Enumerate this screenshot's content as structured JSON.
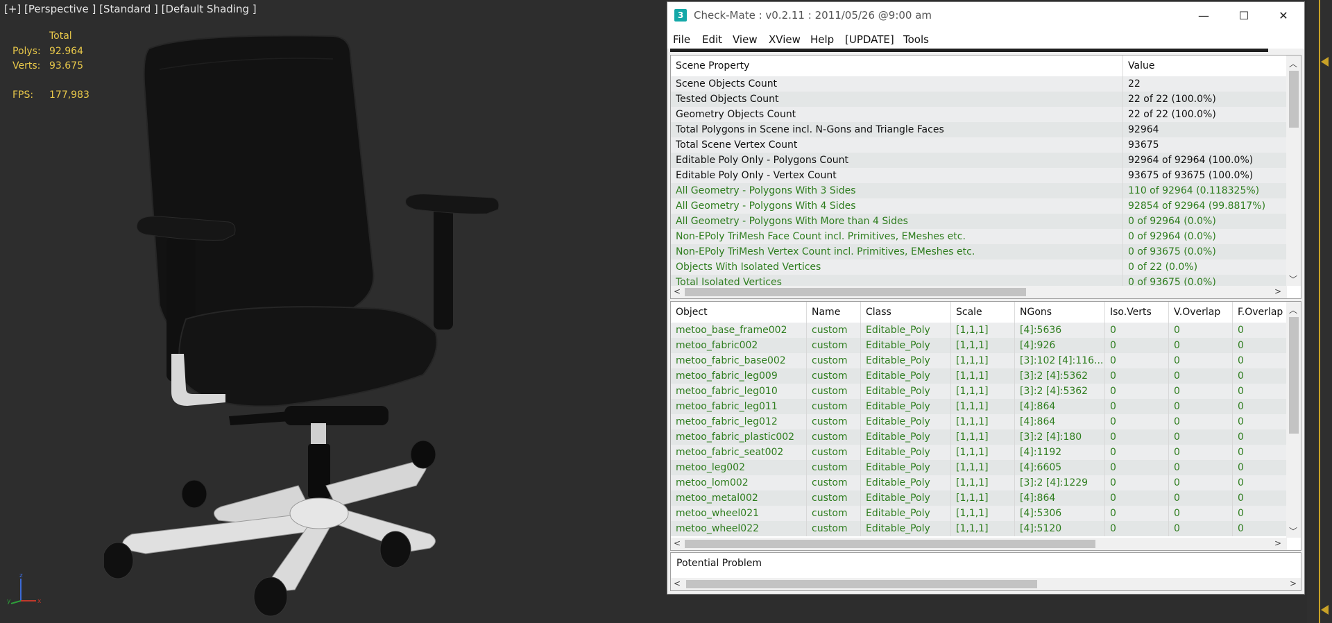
{
  "viewport": {
    "label": "[+] [Perspective ] [Standard ] [Default Shading ]",
    "stats": {
      "total_header": "Total",
      "polys_label": "Polys:",
      "polys_value": "92.964",
      "verts_label": "Verts:",
      "verts_value": "93.675",
      "fps_label": "FPS:",
      "fps_value": "177,983"
    },
    "axis": {
      "x": "x",
      "y": "y",
      "z": "z"
    }
  },
  "window": {
    "icon_text": "3",
    "title": "Check-Mate : v0.2.11 : 2011/05/26 @9:00 am",
    "controls": {
      "minimize": "—",
      "maximize": "☐",
      "close": "✕"
    },
    "menu": [
      "File",
      "Edit",
      "View",
      "XView",
      "Help",
      "[UPDATE]",
      "Tools"
    ]
  },
  "scene_table": {
    "headers": [
      "Scene Property",
      "Value"
    ],
    "rows": [
      {
        "property": "Scene Objects Count",
        "value": "22",
        "highlight": false
      },
      {
        "property": "Tested Objects Count",
        "value": "22 of 22 (100.0%)",
        "highlight": false
      },
      {
        "property": "Geometry Objects Count",
        "value": "22 of 22 (100.0%)",
        "highlight": false
      },
      {
        "property": "Total Polygons in Scene incl. N-Gons and Triangle Faces",
        "value": "92964",
        "highlight": false
      },
      {
        "property": "Total Scene Vertex Count",
        "value": "93675",
        "highlight": false
      },
      {
        "property": "Editable Poly Only - Polygons Count",
        "value": "92964 of 92964 (100.0%)",
        "highlight": false
      },
      {
        "property": "Editable Poly Only - Vertex Count",
        "value": "93675 of 93675 (100.0%)",
        "highlight": false
      },
      {
        "property": "All Geometry - Polygons With 3 Sides",
        "value": "110 of 92964 (0.118325%)",
        "highlight": true
      },
      {
        "property": "All Geometry - Polygons With 4 Sides",
        "value": "92854 of 92964 (99.8817%)",
        "highlight": true
      },
      {
        "property": "All Geometry - Polygons With More than 4 Sides",
        "value": "0 of 92964 (0.0%)",
        "highlight": true
      },
      {
        "property": "Non-EPoly TriMesh Face Count incl. Primitives, EMeshes etc.",
        "value": "0 of 92964 (0.0%)",
        "highlight": true
      },
      {
        "property": "Non-EPoly TriMesh Vertex Count incl. Primitives, EMeshes etc.",
        "value": "0 of 93675 (0.0%)",
        "highlight": true
      },
      {
        "property": "Objects With Isolated Vertices",
        "value": "0 of 22 (0.0%)",
        "highlight": true
      },
      {
        "property": "Total Isolated Vertices",
        "value": "0 of 93675 (0.0%)",
        "highlight": true
      }
    ]
  },
  "object_table": {
    "headers": [
      "Object",
      "Name",
      "Class",
      "Scale",
      "NGons",
      "Iso.Verts",
      "V.Overlap",
      "F.Overlap"
    ],
    "rows": [
      [
        "metoo_base_frame002",
        "custom",
        "Editable_Poly",
        "[1,1,1]",
        "[4]:5636",
        "0",
        "0",
        "0"
      ],
      [
        "metoo_fabric002",
        "custom",
        "Editable_Poly",
        "[1,1,1]",
        "[4]:926",
        "0",
        "0",
        "0"
      ],
      [
        "metoo_fabric_base002",
        "custom",
        "Editable_Poly",
        "[1,1,1]",
        "[3]:102 [4]:116...",
        "0",
        "0",
        "0"
      ],
      [
        "metoo_fabric_leg009",
        "custom",
        "Editable_Poly",
        "[1,1,1]",
        "[3]:2 [4]:5362",
        "0",
        "0",
        "0"
      ],
      [
        "metoo_fabric_leg010",
        "custom",
        "Editable_Poly",
        "[1,1,1]",
        "[3]:2 [4]:5362",
        "0",
        "0",
        "0"
      ],
      [
        "metoo_fabric_leg011",
        "custom",
        "Editable_Poly",
        "[1,1,1]",
        "[4]:864",
        "0",
        "0",
        "0"
      ],
      [
        "metoo_fabric_leg012",
        "custom",
        "Editable_Poly",
        "[1,1,1]",
        "[4]:864",
        "0",
        "0",
        "0"
      ],
      [
        "metoo_fabric_plastic002",
        "custom",
        "Editable_Poly",
        "[1,1,1]",
        "[3]:2 [4]:180",
        "0",
        "0",
        "0"
      ],
      [
        "metoo_fabric_seat002",
        "custom",
        "Editable_Poly",
        "[1,1,1]",
        "[4]:1192",
        "0",
        "0",
        "0"
      ],
      [
        "metoo_leg002",
        "custom",
        "Editable_Poly",
        "[1,1,1]",
        "[4]:6605",
        "0",
        "0",
        "0"
      ],
      [
        "metoo_lom002",
        "custom",
        "Editable_Poly",
        "[1,1,1]",
        "[3]:2 [4]:1229",
        "0",
        "0",
        "0"
      ],
      [
        "metoo_metal002",
        "custom",
        "Editable_Poly",
        "[1,1,1]",
        "[4]:864",
        "0",
        "0",
        "0"
      ],
      [
        "metoo_wheel021",
        "custom",
        "Editable_Poly",
        "[1,1,1]",
        "[4]:5306",
        "0",
        "0",
        "0"
      ],
      [
        "metoo_wheel022",
        "custom",
        "Editable_Poly",
        "[1,1,1]",
        "[4]:5120",
        "0",
        "0",
        "0"
      ]
    ]
  },
  "problem_panel": {
    "label": "Potential Problem"
  },
  "colors": {
    "accent_yellow": "#e8c84a",
    "highlight_green": "#2e7d1e",
    "object_green": "#2e7d1e",
    "row_even": "#ecedee",
    "row_odd": "#e3e6e6",
    "viewport_bg": "#2d2d2d"
  }
}
